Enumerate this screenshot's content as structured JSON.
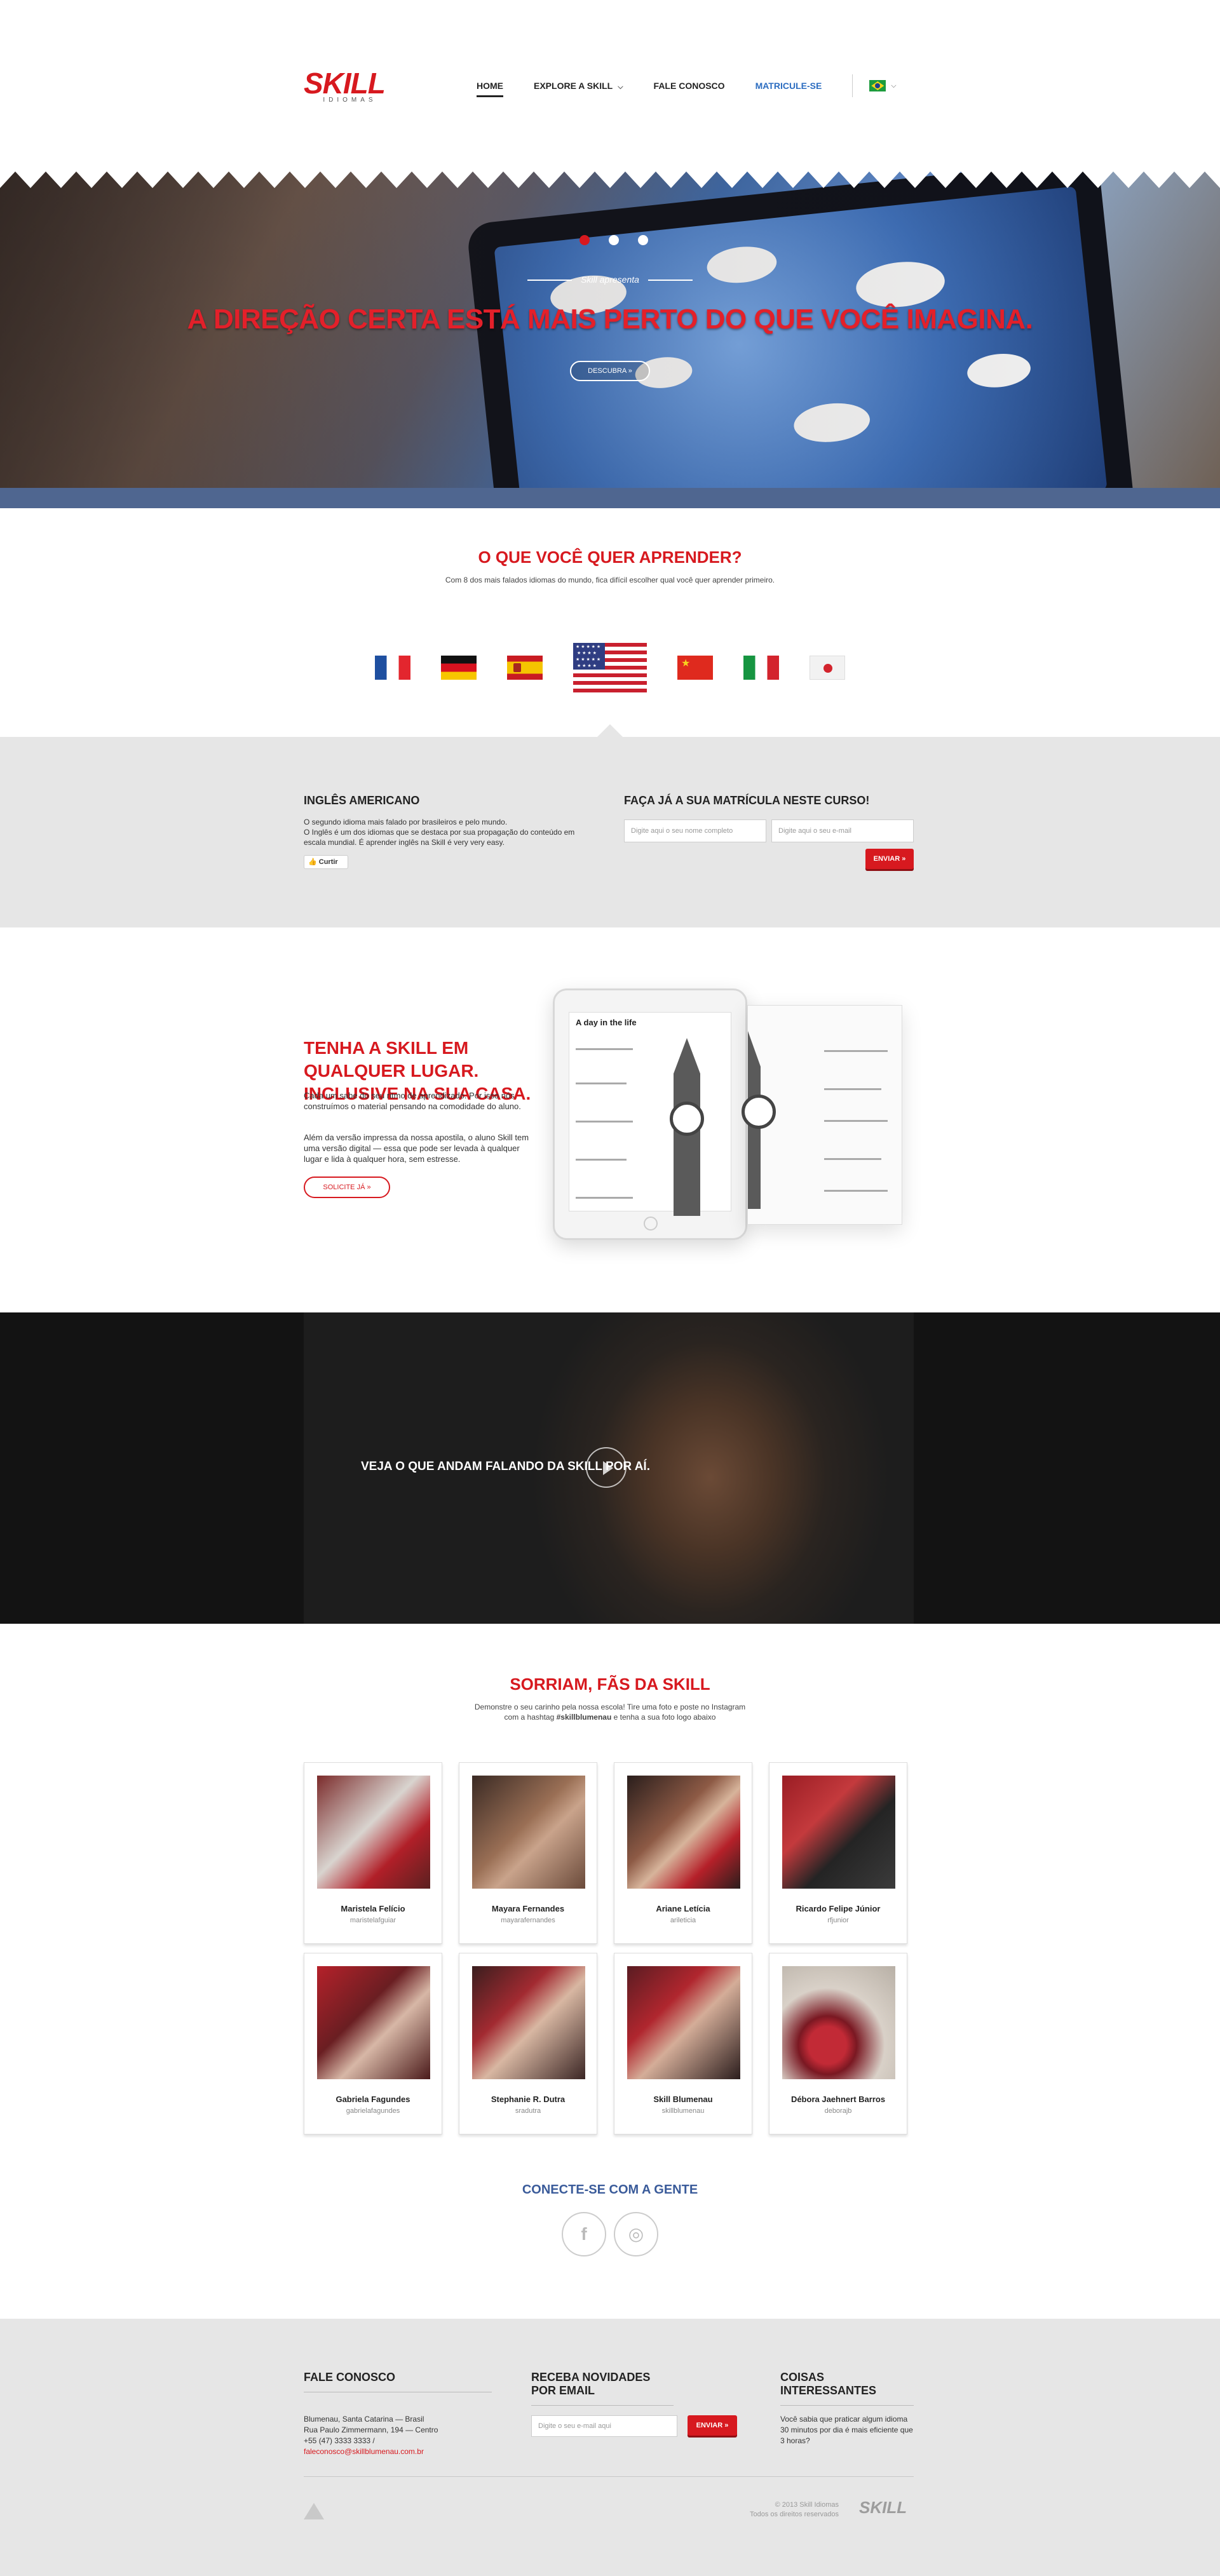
{
  "header": {
    "logo_text": "SKILL",
    "logo_sub": "IDIOMAS",
    "nav": [
      {
        "label": "HOME"
      },
      {
        "label": "EXPLORE A SKILL"
      },
      {
        "label": "FALE CONOSCO"
      },
      {
        "label": "MATRICULE-SE"
      }
    ],
    "language_flag": "brazil-flag-icon"
  },
  "hero": {
    "kicker": "Skill apresenta",
    "title": "A DIREÇÃO CERTA ESTÁ MAIS PERTO DO QUE VOCÊ IMAGINA.",
    "button": "DESCUBRA »",
    "slides": 3,
    "active_slide": 1
  },
  "languages": {
    "title": "O QUE VOCÊ QUER APRENDER?",
    "subtitle": "Com 8 dos mais falados idiomas do mundo, fica difícil escolher qual você quer aprender primeiro.",
    "flags": [
      "france-flag-icon",
      "germany-flag-icon",
      "spain-flag-icon",
      "usa-flag-icon",
      "china-flag-icon",
      "italy-flag-icon",
      "japan-flag-icon"
    ],
    "selected": "usa-flag-icon"
  },
  "course": {
    "title": "INGLÊS AMERICANO",
    "text_1": "O segundo idioma mais falado por brasileiros e pelo mundo.",
    "text_2": "O Inglês é um dos idiomas que se destaca por sua propagação do conteúdo em escala mundial. É aprender inglês na Skill é very very easy.",
    "like": "Curtir",
    "enroll_title": "FAÇA JÁ A SUA MATRÍCULA NESTE CURSO!",
    "name_placeholder": "Digite aqui o seu nome completo",
    "email_placeholder": "Digite aqui o seu e-mail",
    "submit": "ENVIAR »"
  },
  "anywhere": {
    "title": "TENHA A SKILL EM QUALQUER LUGAR. INCLUSIVE NA SUA CASA.",
    "p1": "Cada um sabe do seu ritmo de aprendizado. Por isso nós construímos o material pensando na comodidade do aluno.",
    "p2": "Além da versão impressa da nossa apostila, o aluno Skill tem uma versão digital — essa que pode ser levada à qualquer lugar e lida à qualquer hora, sem estresse.",
    "button": "SOLICITE JÁ »",
    "ipad_heading": "A day in the life"
  },
  "video": {
    "title": "VEJA O QUE ANDAM FALANDO DA SKILL POR AÍ."
  },
  "fans": {
    "title": "SORRIAM, FÃS DA SKILL",
    "subtitle_1": "Demonstre o seu carinho pela nossa escola! Tire uma foto e poste no Instagram",
    "subtitle_2_pre": "com a hashtag ",
    "hashtag": "#skillblumenau",
    "subtitle_2_post": " e tenha a sua foto logo abaixo",
    "cards": [
      {
        "name": "Maristela Felício",
        "handle": "maristelafguiar"
      },
      {
        "name": "Mayara Fernandes",
        "handle": "mayarafernandes"
      },
      {
        "name": "Ariane Letícia",
        "handle": "arileticia"
      },
      {
        "name": "Ricardo Felipe Júnior",
        "handle": "rfjunior"
      },
      {
        "name": "Gabriela Fagundes",
        "handle": "gabrielafagundes"
      },
      {
        "name": "Stephanie R. Dutra",
        "handle": "sradutra"
      },
      {
        "name": "Skill Blumenau",
        "handle": "skillblumenau"
      },
      {
        "name": "Débora Jaehnert Barros",
        "handle": "deborajb"
      }
    ],
    "connect_title": "CONECTE-SE COM A GENTE",
    "social": [
      "facebook-icon",
      "instagram-icon"
    ]
  },
  "footer": {
    "contact_title": "FALE CONOSCO",
    "address_1": "Blumenau, Santa Catarina — Brasil",
    "address_2": "Rua Paulo Zimmermann, 194 — Centro",
    "phone": "+55 (47) 3333 3333",
    "email": "faleconosco@skillblumenau.com.br",
    "newsletter_title": "RECEBA NOVIDADES POR EMAIL",
    "newsletter_placeholder": "Digite o seu e-mail aqui",
    "newsletter_submit": "ENVIAR »",
    "facts_title": "COISAS INTERESSANTES",
    "fact": "Você sabia que praticar algum idioma 30 minutos por dia é mais eficiente que 3 horas?",
    "copyright_1": "© 2013 Skill Idiomas",
    "copyright_2": "Todos os direitos reservados",
    "footer_logo": "SKILL"
  },
  "colors": {
    "brand_red": "#d7191f",
    "link_blue": "#2b6cc0",
    "band_blue": "#4f6690",
    "panel_gray": "#e6e6e6"
  }
}
